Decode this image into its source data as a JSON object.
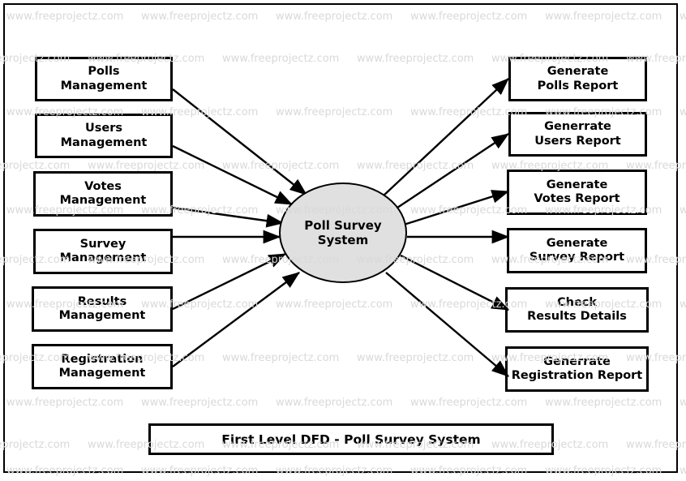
{
  "diagram": {
    "title": "First Level DFD - Poll Survey System",
    "process": {
      "label": "Poll Survey\nSystem",
      "fill_color": "#e0e0e0",
      "stroke_color": "#000000"
    },
    "watermark": {
      "text": "www.freeprojectz.com",
      "color": "#d9d9d9"
    },
    "inputs": [
      {
        "label": "Polls\nManagement"
      },
      {
        "label": "Users\nManagement"
      },
      {
        "label": "Votes\nManagement"
      },
      {
        "label": "Survey\nManagement"
      },
      {
        "label": "Results\nManagement"
      },
      {
        "label": "Registration\nManagement"
      }
    ],
    "outputs": [
      {
        "label": "Generate\nPolls Report"
      },
      {
        "label": "Generrate\nUsers Report"
      },
      {
        "label": "Generate\nVotes Report"
      },
      {
        "label": "Generate\nSurvey Report"
      },
      {
        "label": "Check\nResults Details"
      },
      {
        "label": "Generrate\nRegistration Report"
      }
    ]
  }
}
